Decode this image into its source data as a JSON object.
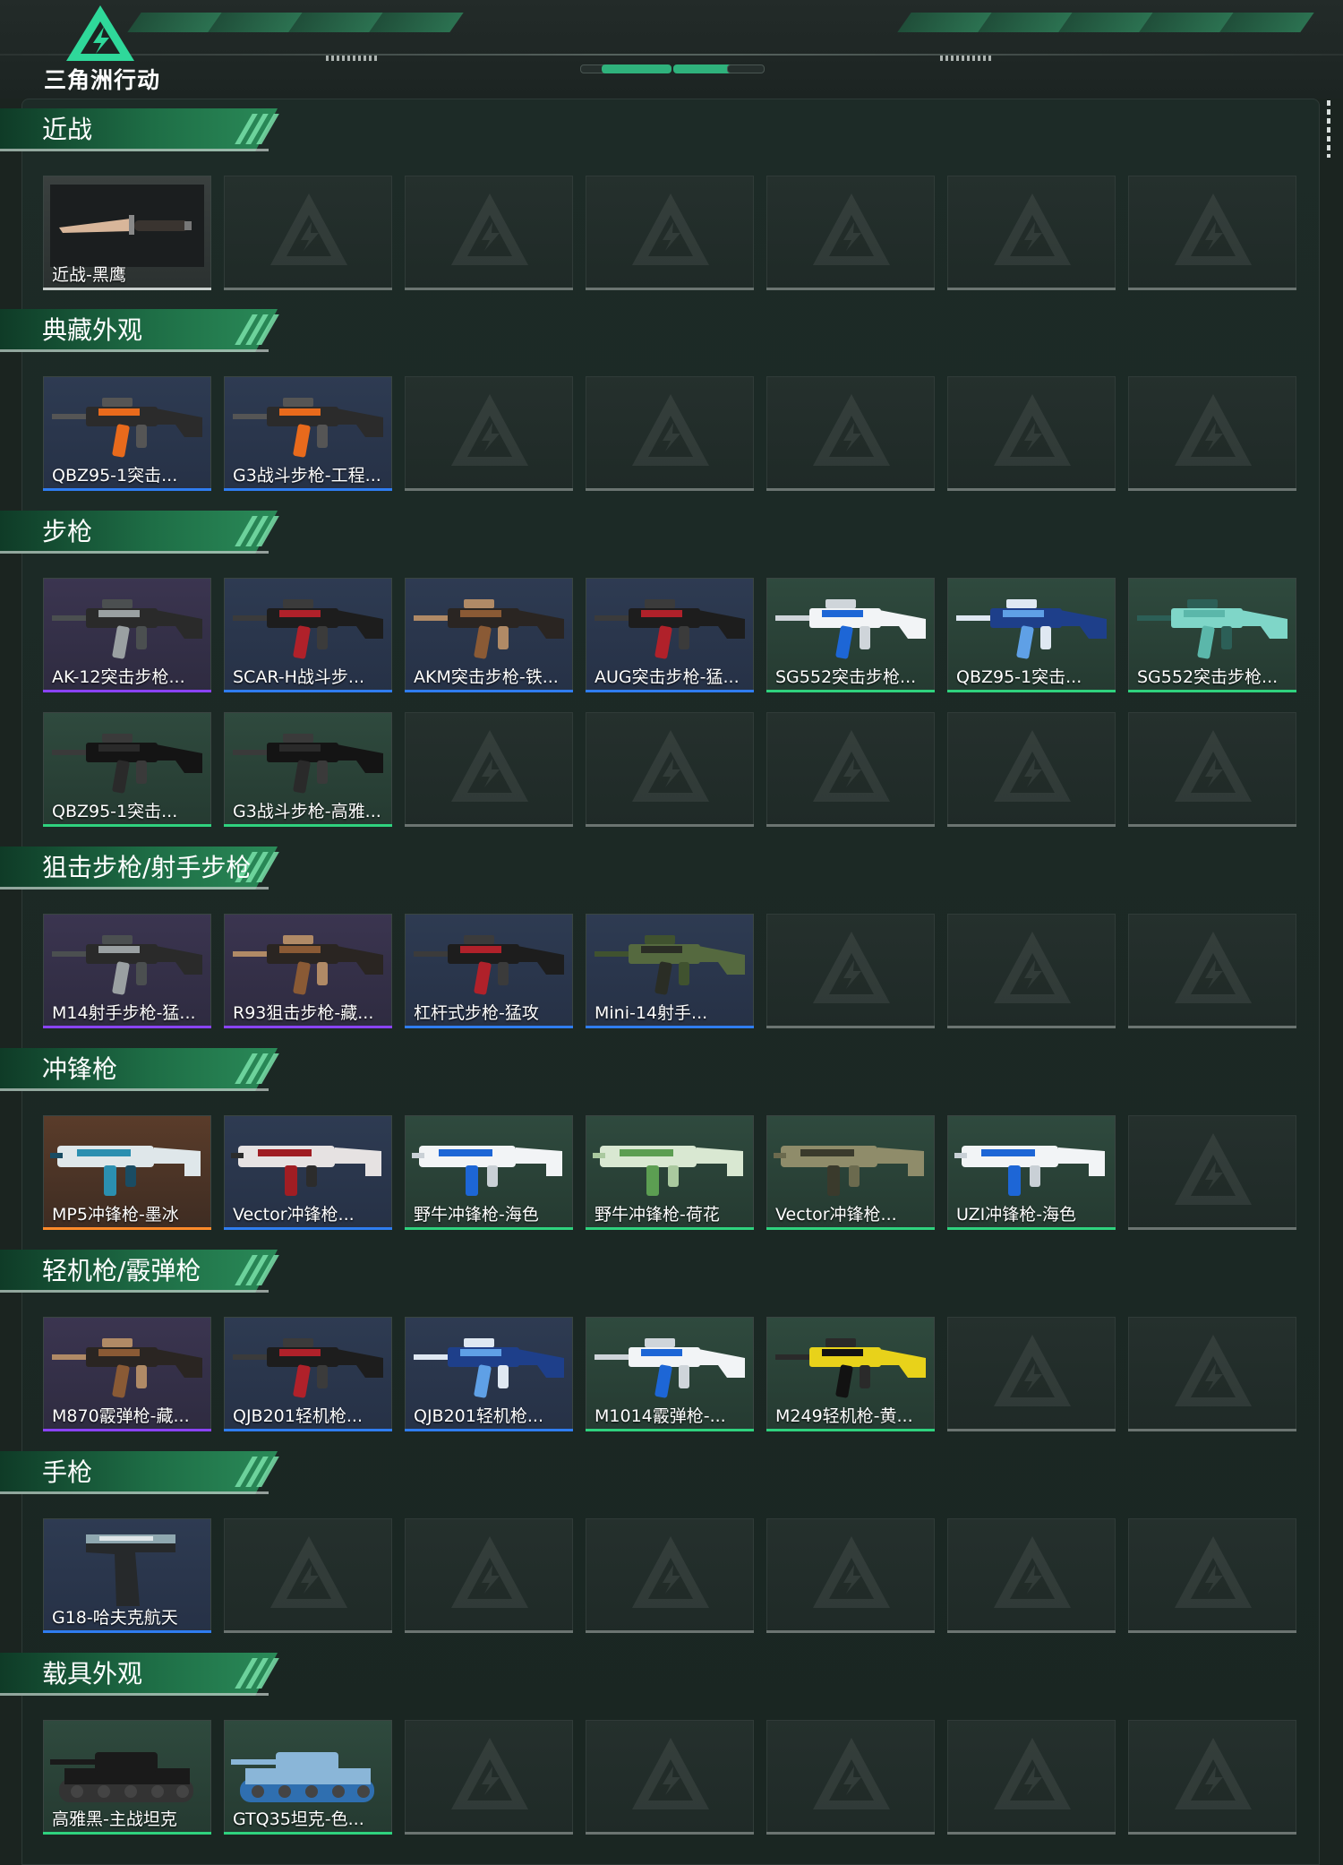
{
  "app": {
    "logo_text": "三角洲行动"
  },
  "colors": {
    "accent": "#2fb27c",
    "purple": "#8a43ff",
    "blue": "#2f7df0",
    "green": "#2fd27e",
    "orange": "#ff8a2a"
  },
  "sections": [
    {
      "title": "近战",
      "rows": [
        [
          {
            "label": "近战-黑鹰",
            "rarity": "gray",
            "icon": "knife"
          }
        ]
      ]
    },
    {
      "title": "典藏外观",
      "rows": [
        [
          {
            "label": "QBZ95-1突击...",
            "rarity": "blue",
            "icon": "rifle-orange"
          },
          {
            "label": "G3战斗步枪-工程...",
            "rarity": "blue",
            "icon": "rifle-orange"
          }
        ]
      ]
    },
    {
      "title": "步枪",
      "rows": [
        [
          {
            "label": "AK-12突击步枪...",
            "rarity": "purple",
            "icon": "rifle-gray"
          },
          {
            "label": "SCAR-H战斗步...",
            "rarity": "blue",
            "icon": "rifle-red"
          },
          {
            "label": "AKM突击步枪-铁...",
            "rarity": "blue",
            "icon": "rifle-brown"
          },
          {
            "label": "AUG突击步枪-猛...",
            "rarity": "blue",
            "icon": "rifle-red"
          },
          {
            "label": "SG552突击步枪...",
            "rarity": "green",
            "icon": "rifle-white-blue"
          },
          {
            "label": "QBZ95-1突击...",
            "rarity": "green",
            "icon": "rifle-blue"
          },
          {
            "label": "SG552突击步枪...",
            "rarity": "green",
            "icon": "rifle-teal"
          }
        ],
        [
          {
            "label": "QBZ95-1突击...",
            "rarity": "green",
            "icon": "rifle-black"
          },
          {
            "label": "G3战斗步枪-高雅...",
            "rarity": "green",
            "icon": "rifle-black"
          }
        ]
      ]
    },
    {
      "title": "狙击步枪/射手步枪",
      "rows": [
        [
          {
            "label": "M14射手步枪-猛...",
            "rarity": "purple",
            "icon": "rifle-gray"
          },
          {
            "label": "R93狙击步枪-藏...",
            "rarity": "purple",
            "icon": "rifle-brown"
          },
          {
            "label": "杠杆式步枪-猛攻",
            "rarity": "blue",
            "icon": "rifle-red"
          },
          {
            "label": "Mini-14射手...",
            "rarity": "blue",
            "icon": "rifle-olive"
          }
        ]
      ]
    },
    {
      "title": "冲锋枪",
      "rows": [
        [
          {
            "label": "MP5冲锋枪-墨冰",
            "rarity": "orange",
            "icon": "smg-teal"
          },
          {
            "label": "Vector冲锋枪...",
            "rarity": "blue",
            "icon": "smg-red"
          },
          {
            "label": "野牛冲锋枪-海色",
            "rarity": "green",
            "icon": "smg-white-blue"
          },
          {
            "label": "野牛冲锋枪-荷花",
            "rarity": "green",
            "icon": "smg-green"
          },
          {
            "label": "Vector冲锋枪...",
            "rarity": "green",
            "icon": "smg-camo"
          },
          {
            "label": "UZI冲锋枪-海色",
            "rarity": "green",
            "icon": "smg-white-blue"
          }
        ]
      ]
    },
    {
      "title": "轻机枪/霰弹枪",
      "rows": [
        [
          {
            "label": "M870霰弹枪-藏...",
            "rarity": "purple",
            "icon": "rifle-brown"
          },
          {
            "label": "QJB201轻机枪...",
            "rarity": "blue",
            "icon": "rifle-red"
          },
          {
            "label": "QJB201轻机枪...",
            "rarity": "blue",
            "icon": "rifle-blue"
          },
          {
            "label": "M1014霰弹枪-...",
            "rarity": "green",
            "icon": "rifle-white-blue"
          },
          {
            "label": "M249轻机枪-黄...",
            "rarity": "green",
            "icon": "rifle-yellow"
          }
        ]
      ]
    },
    {
      "title": "手枪",
      "rows": [
        [
          {
            "label": "G18-哈夫克航天",
            "rarity": "blue",
            "icon": "pistol"
          }
        ]
      ]
    },
    {
      "title": "载具外观",
      "rows": [
        [
          {
            "label": "高雅黑-主战坦克",
            "rarity": "green",
            "icon": "tank-black"
          },
          {
            "label": "GTQ35坦克-色...",
            "rarity": "green",
            "icon": "tank-blue"
          }
        ]
      ]
    }
  ]
}
